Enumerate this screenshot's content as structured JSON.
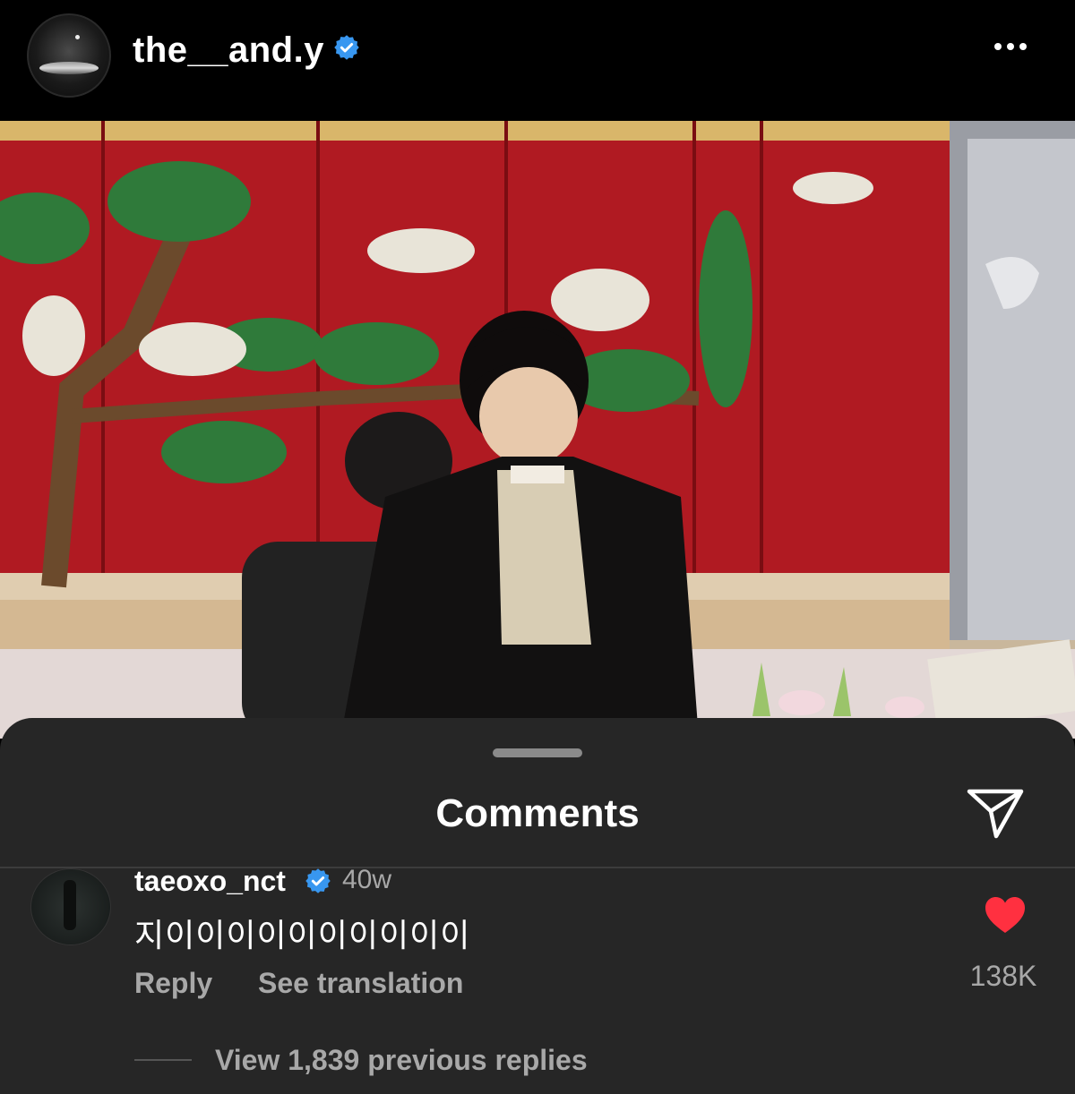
{
  "post": {
    "username": "the__and.y",
    "verified": true
  },
  "comments_sheet": {
    "title": "Comments",
    "comment": {
      "username": "taeoxo_nct",
      "time": "40w",
      "text": "지이이이이이이이이이이",
      "reply_label": "Reply",
      "translate_label": "See translation",
      "like_count": "138K",
      "view_replies_label": "View 1,839 previous replies"
    }
  },
  "colors": {
    "verified_blue": "#3897f0",
    "like_red": "#ff3040",
    "sheet_bg": "#262626",
    "muted_text": "#a8a8a8"
  },
  "icons": [
    "more-icon",
    "verified-badge-icon",
    "share-icon",
    "heart-icon"
  ]
}
